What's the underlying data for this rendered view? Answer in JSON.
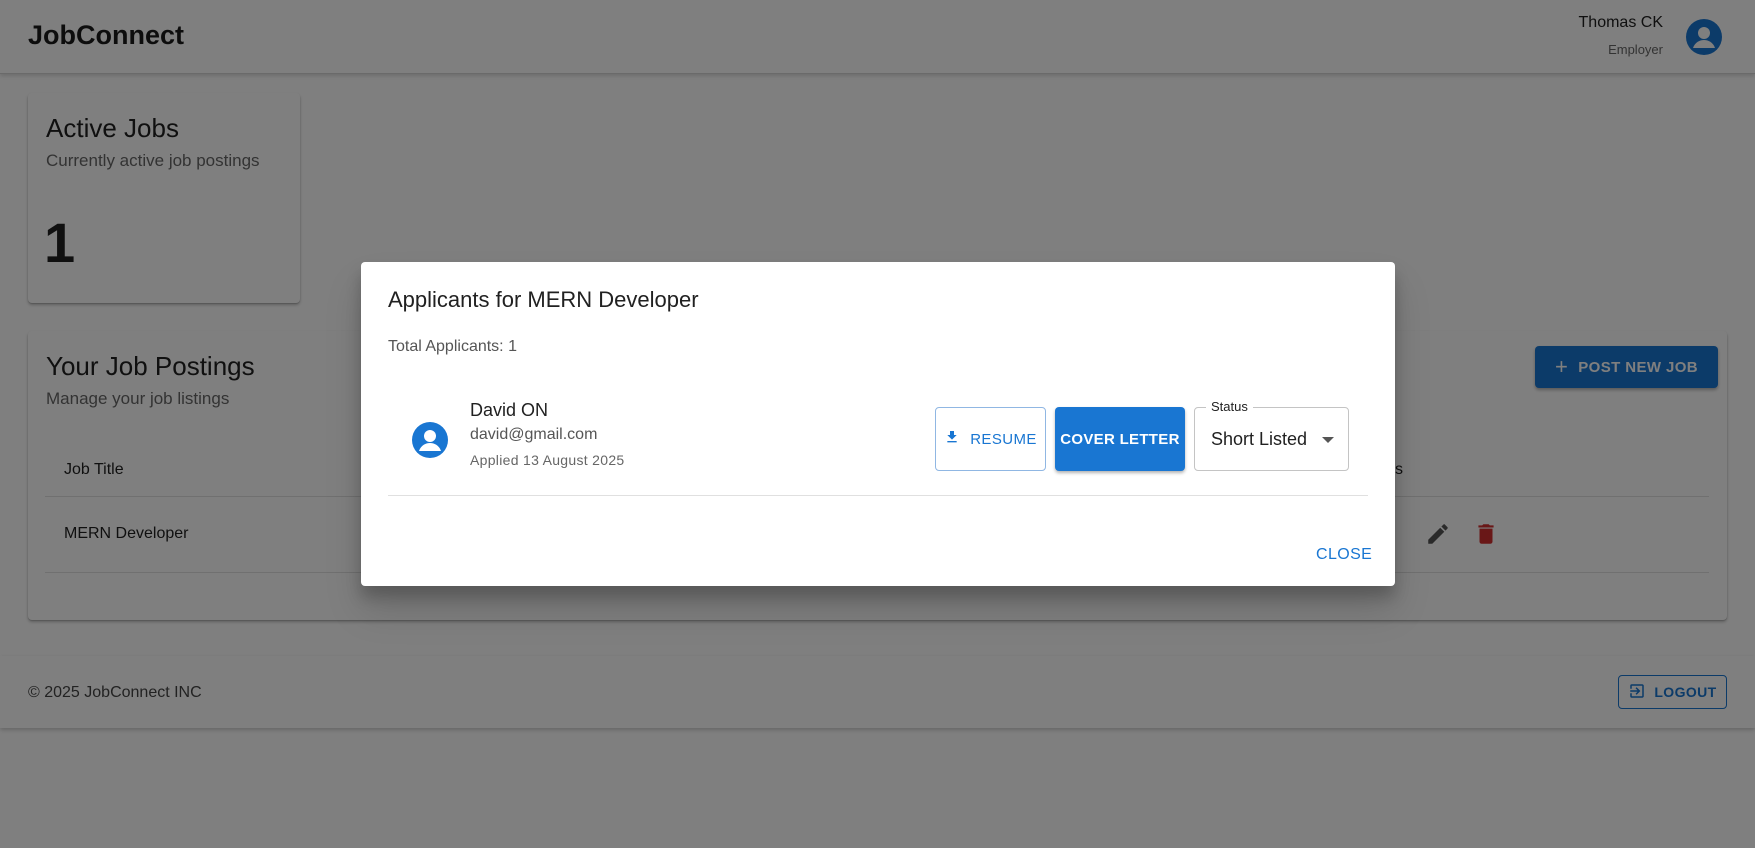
{
  "header": {
    "brand": "JobConnect",
    "user_name": "Thomas CK",
    "user_role": "Employer"
  },
  "stats": {
    "title": "Active Jobs",
    "subtitle": "Currently active job postings",
    "value": "1"
  },
  "postings": {
    "title": "Your Job Postings",
    "subtitle": "Manage your job listings",
    "post_button": "POST NEW JOB",
    "columns": {
      "job_title": "Job Title",
      "actions_partial": "s"
    },
    "rows": [
      {
        "title": "MERN Developer"
      }
    ]
  },
  "footer": {
    "copyright": "© 2025 JobConnect INC",
    "logout": "LOGOUT"
  },
  "dialog": {
    "title": "Applicants for MERN Developer",
    "total": "Total Applicants: 1",
    "applicants": [
      {
        "name": "David ON",
        "email": "david@gmail.com",
        "applied": "Applied 13 August 2025",
        "resume": "RESUME",
        "cover_letter": "COVER LETTER",
        "status_label": "Status",
        "status_value": "Short Listed"
      }
    ],
    "close": "CLOSE"
  },
  "colors": {
    "primary": "#1976d2",
    "danger": "#d32f2f",
    "backdrop": "rgba(0,0,0,0.5)"
  }
}
